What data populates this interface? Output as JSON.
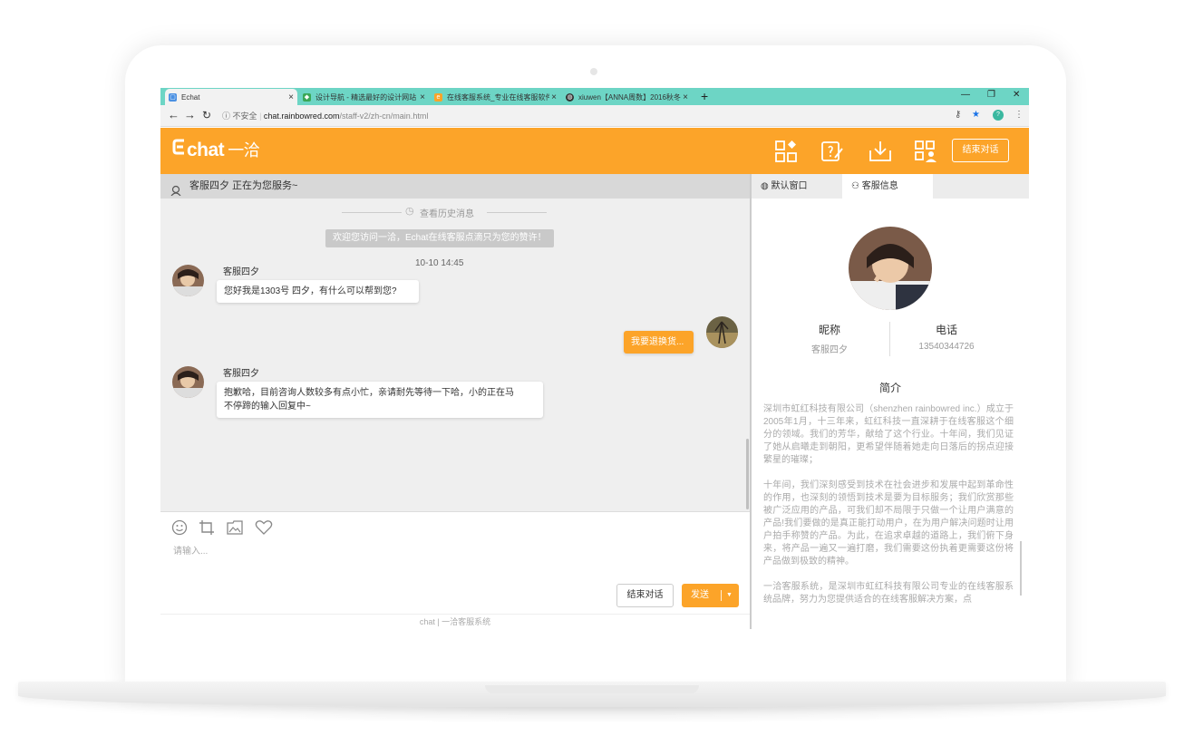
{
  "browser": {
    "tabs": [
      {
        "title": "Echat",
        "favicon_color": "#4a90e2"
      },
      {
        "title": "设计导航 - 精选最好的设计网站",
        "favicon_color": "#3aa757"
      },
      {
        "title": "在线客服系统_专业在线客服软件",
        "favicon_color": "#fca429"
      },
      {
        "title": "xiuwen【ANNA周数】2016秋冬",
        "favicon_color": "#333333"
      }
    ],
    "security_label": "不安全",
    "url_host": "chat.rainbowred.com",
    "url_path": "/staff-v2/zh-cn/main.html",
    "profile_initial": "?"
  },
  "app": {
    "logo_text": "chat",
    "logo_cn": "一洽",
    "end_button": "结束对话",
    "accent_color": "#fca429"
  },
  "chat": {
    "status": "客服四夕 正在为您服务~",
    "history_link": "查看历史消息",
    "system_message": "欢迎您访问一洽，Echat在线客服点滴只为您的赞许！",
    "timestamp": "10-10 14:45",
    "messages": [
      {
        "sender": "客服四夕",
        "text": "您好我是1303号 四夕，有什么可以帮到您?"
      },
      {
        "sender": "me",
        "text": "我要退换货..."
      },
      {
        "sender": "客服四夕",
        "text_line1": "抱歉哈，目前咨询人数较多有点小忙，亲请耐先等待一下哈，小的正在马",
        "text_line2": "不停蹄的输入回复中~"
      }
    ],
    "input_placeholder": "请输入...",
    "end_button": "结束对话",
    "send_button": "发送",
    "footer": "一洽客服系统",
    "footer_logo": "chat"
  },
  "sidebar": {
    "tab_default": "默认窗口",
    "tab_info": "客服信息",
    "nickname_label": "昵称",
    "nickname_value": "客服四夕",
    "phone_label": "电话",
    "phone_value": "13540344726",
    "intro_heading": "简介",
    "intro_p1": "深圳市虹红科技有限公司（shenzhen rainbowred inc.）成立于2005年1月，十三年来，虹红科技一直深耕于在线客服这个细分的领域。我们的芳华，献给了这个行业。十年间，我们见证了她从启曦走到朝阳，更希望伴随着她走向日落后的拐点迎接繁星的璀璨；",
    "intro_p2": "十年间，我们深刻感受到技术在社会进步和发展中起到革命性的作用，也深刻的领悟到技术是要为目标服务；我们欣赏那些被广泛应用的产品，可我们却不局限于只做一个让用户满意的产品!我们要做的是真正能打动用户，在为用户解决问题时让用户拍手称赞的产品。为此，在追求卓越的道路上，我们俯下身来，将产品一遍又一遍打磨，我们需要这份执着更需要这份将产品做到极致的精神。",
    "intro_p3": "一洽客服系统，是深圳市虹红科技有限公司专业的在线客服系统品牌，努力为您提供适合的在线客服解决方案，点"
  }
}
